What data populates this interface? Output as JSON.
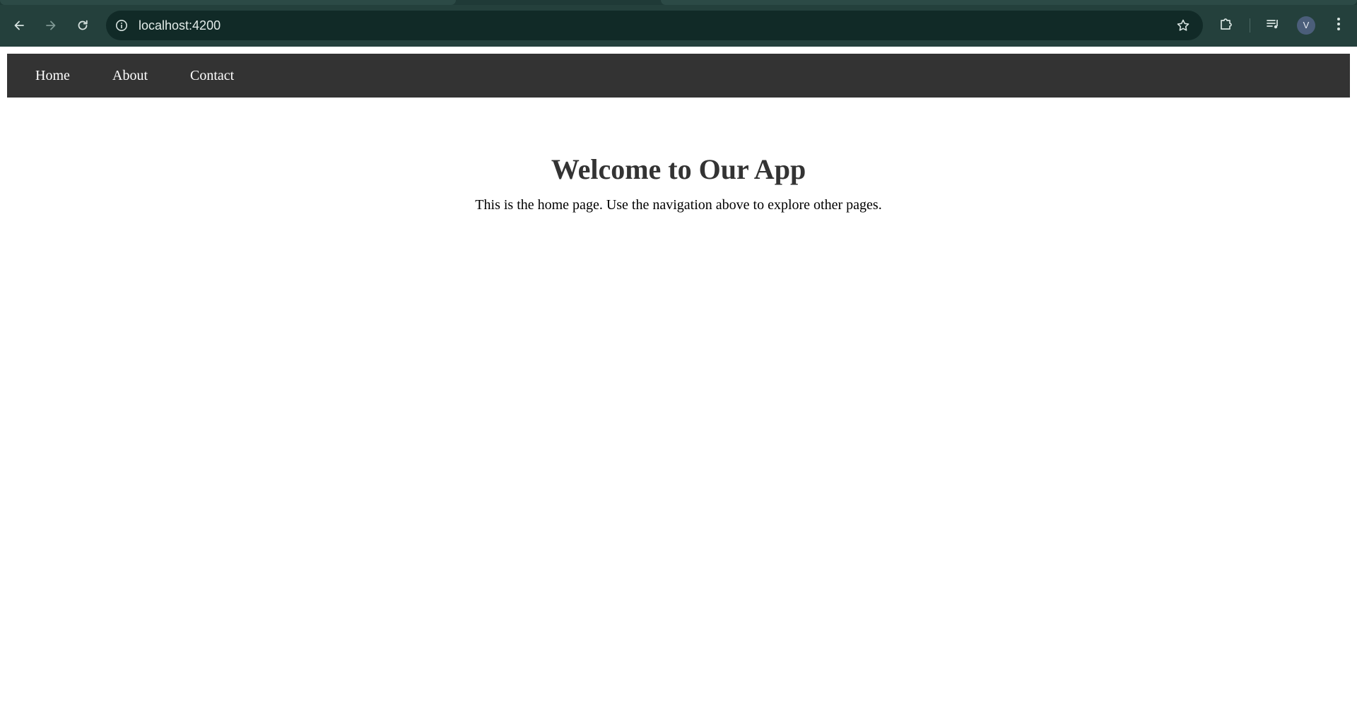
{
  "browser": {
    "url": "localhost:4200",
    "profile_initial": "V",
    "icons": {
      "back": "arrow-left-icon",
      "forward": "arrow-right-icon",
      "reload": "reload-icon",
      "site_info": "info-icon",
      "bookmark": "star-icon",
      "extensions": "puzzle-icon",
      "media": "media-queue-icon",
      "menu": "kebab-menu-icon"
    },
    "colors": {
      "frame": "#1f3a37",
      "toolbar": "#24403c",
      "omnibox": "#112a27"
    }
  },
  "navbar": {
    "background": "#333333",
    "links": [
      {
        "label": "Home"
      },
      {
        "label": "About"
      },
      {
        "label": "Contact"
      }
    ]
  },
  "main": {
    "heading": "Welcome to Our App",
    "text": "This is the home page. Use the navigation above to explore other pages."
  }
}
